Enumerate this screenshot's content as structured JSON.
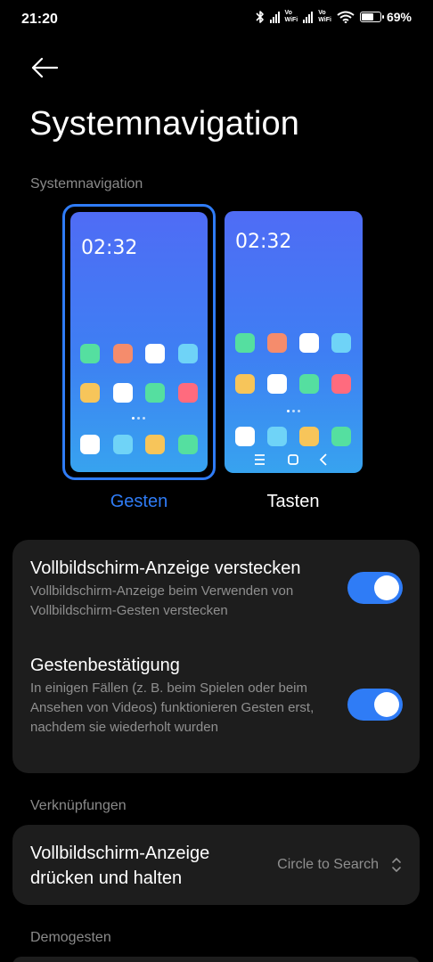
{
  "status_bar": {
    "time": "21:20",
    "vowifi_1": "Vo\nWiFi",
    "vowifi_2": "Vo\nWiFi",
    "battery_percent": "69%",
    "battery_level": 0.69
  },
  "header": {
    "back_icon": "back-arrow-icon",
    "title": "Systemnavigation"
  },
  "nav_section": {
    "label": "Systemnavigation",
    "options": [
      {
        "label": "Gesten",
        "clock": "02:32",
        "selected": true
      },
      {
        "label": "Tasten",
        "clock": "02:32",
        "selected": false
      }
    ]
  },
  "settings_card": {
    "items": [
      {
        "title": "Vollbildschirm-Anzeige verstecken",
        "subtitle": "Vollbildschirm-Anzeige beim Verwenden von Vollbildschirm-Gesten verstecken",
        "enabled": true
      },
      {
        "title": "Gestenbestätigung",
        "subtitle": "In einigen Fällen (z. B. beim Spielen oder beim Ansehen von Videos) funktionieren Gesten erst, nachdem sie wiederholt wurden",
        "enabled": true
      }
    ]
  },
  "shortcuts_section": {
    "label": "Verknüpfungen",
    "item": {
      "title_line1": "Vollbildschirm-Anzeige",
      "title_line2": "drücken und halten",
      "value": "Circle to Search"
    }
  },
  "demo_section": {
    "label": "Demogesten"
  },
  "colors": {
    "accent": "#2f7cf6",
    "card_bg": "#1d1d1d",
    "secondary_text": "#8f8f8f",
    "section_label": "#8a8a8a",
    "app_icon_colors": [
      "#55dfa0",
      "#f58c6c",
      "#ffffff",
      "#6fd3f7",
      "#f7c55a",
      "#ff6b7e"
    ]
  }
}
